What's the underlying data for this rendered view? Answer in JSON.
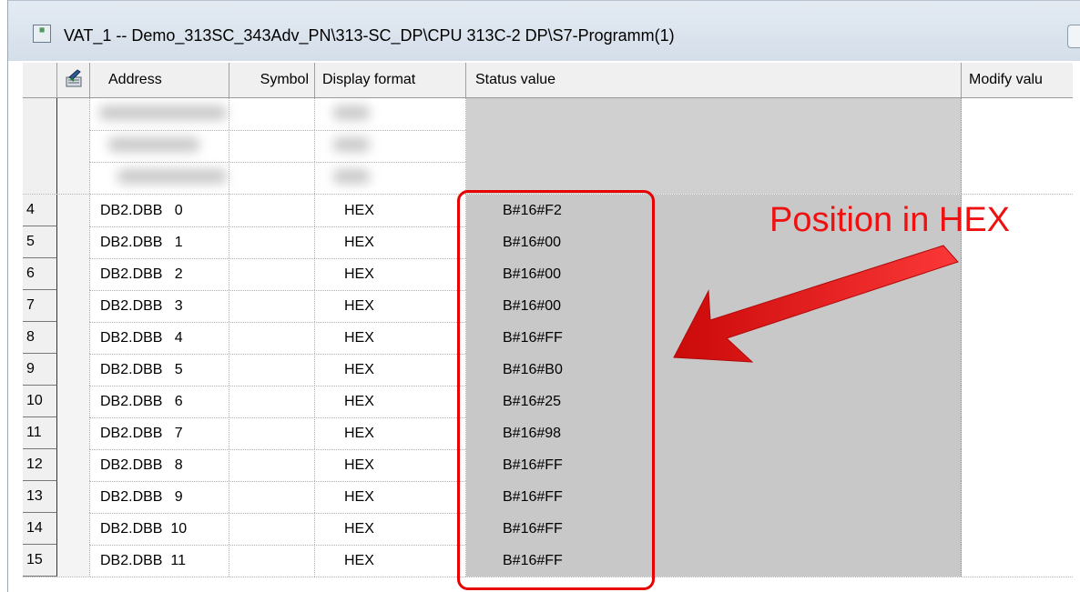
{
  "window": {
    "title": "VAT_1 -- Demo_313SC_343Adv_PN\\313-SC_DP\\CPU 313C-2 DP\\S7-Programm(1)",
    "icon_name": "vat-table-icon"
  },
  "table": {
    "columns": {
      "modify_icon": "modify-column-icon",
      "address": "Address",
      "symbol": "Symbol",
      "display_format": "Display format",
      "status_value": "Status value",
      "modify_value": "Modify valu"
    },
    "rows": [
      {
        "index": "4",
        "address": "DB2.DBB   0",
        "symbol": "",
        "format": "HEX",
        "status": "B#16#F2",
        "modify": ""
      },
      {
        "index": "5",
        "address": "DB2.DBB   1",
        "symbol": "",
        "format": "HEX",
        "status": "B#16#00",
        "modify": ""
      },
      {
        "index": "6",
        "address": "DB2.DBB   2",
        "symbol": "",
        "format": "HEX",
        "status": "B#16#00",
        "modify": ""
      },
      {
        "index": "7",
        "address": "DB2.DBB   3",
        "symbol": "",
        "format": "HEX",
        "status": "B#16#00",
        "modify": ""
      },
      {
        "index": "8",
        "address": "DB2.DBB   4",
        "symbol": "",
        "format": "HEX",
        "status": "B#16#FF",
        "modify": ""
      },
      {
        "index": "9",
        "address": "DB2.DBB   5",
        "symbol": "",
        "format": "HEX",
        "status": "B#16#B0",
        "modify": ""
      },
      {
        "index": "10",
        "address": "DB2.DBB   6",
        "symbol": "",
        "format": "HEX",
        "status": "B#16#25",
        "modify": ""
      },
      {
        "index": "11",
        "address": "DB2.DBB   7",
        "symbol": "",
        "format": "HEX",
        "status": "B#16#98",
        "modify": ""
      },
      {
        "index": "12",
        "address": "DB2.DBB   8",
        "symbol": "",
        "format": "HEX",
        "status": "B#16#FF",
        "modify": ""
      },
      {
        "index": "13",
        "address": "DB2.DBB   9",
        "symbol": "",
        "format": "HEX",
        "status": "B#16#FF",
        "modify": ""
      },
      {
        "index": "14",
        "address": "DB2.DBB  10",
        "symbol": "",
        "format": "HEX",
        "status": "B#16#FF",
        "modify": ""
      },
      {
        "index": "15",
        "address": "DB2.DBB  11",
        "symbol": "",
        "format": "HEX",
        "status": "B#16#FF",
        "modify": ""
      }
    ]
  },
  "annotation": {
    "label": "Position in HEX",
    "color": "#e60000"
  }
}
